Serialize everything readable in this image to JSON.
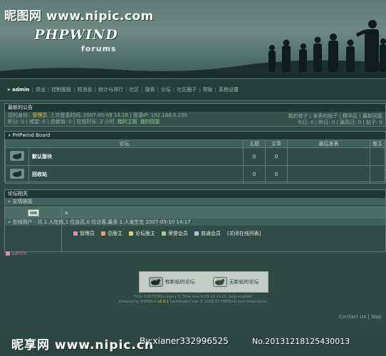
{
  "watermark": {
    "top": "昵图网 www.nipic.com",
    "bottom_brand": "昵享网 www.nipic.cn",
    "author": "By:xianer332996525",
    "number": "No.20131218125430013"
  },
  "logo": {
    "title": "PHPWIND",
    "subtitle": "forums"
  },
  "nav": {
    "user": "admin",
    "items": [
      "退出",
      "控制面板",
      "短消息",
      "统计与排行",
      "社区",
      "搜索",
      "论坛",
      "社区圈子",
      "帮助",
      "系统设置"
    ]
  },
  "notice": {
    "title": "最新的公告",
    "line1_prefix": "您的身份:",
    "admin_name": "管理员",
    "line1_rest": "上次登录时间: 2007-05-09 14:18 | 登录IP: 192.168.0.100",
    "line2": "积分: 0 | 威望: 0 | 贡献值: 0 | 在线时长: 2 小时",
    "line2_link1": "我的主题",
    "line2_link2": "我的回复",
    "right1": "我的帖子 | 发表的帖子 | 精华区 | 最新回复",
    "right2": "今日: 0 | 昨日: 0 | 最高日: 0 | 帖子: 0"
  },
  "board": {
    "title": "» PHPwind Board",
    "columns": [
      "论坛",
      "主题",
      "文章",
      "最后发表",
      "版主"
    ],
    "rows": [
      {
        "name": "默认版块",
        "topics": "0",
        "posts": "0"
      },
      {
        "name": "回收站",
        "topics": "0",
        "posts": "0"
      }
    ]
  },
  "related": {
    "title": "论坛相关",
    "links_head": "» 友情链接",
    "links_value": "a",
    "online_head": "» 在线用户 - 共 1 人在线,1 位会员,0 位访客,最多 1 人发生在 2007-05-10 14:17",
    "legend": [
      {
        "label": "管理员",
        "color": "#d98cb0"
      },
      {
        "label": "总版主",
        "color": "#d6a56a"
      },
      {
        "label": "论坛版主",
        "color": "#d9d07a"
      },
      {
        "label": "荣誉会员",
        "color": "#9bd08b"
      },
      {
        "label": "普通会员",
        "color": "#a9c4dc"
      }
    ],
    "legend_link": "[关闭在线列表]",
    "online_user": "admin"
  },
  "status": {
    "new": "有新帖的论坛",
    "nonew": "无新帖的论坛"
  },
  "footer": {
    "line1": "Total 0.007658(s) query 3, Time now is:05-10 14:22, Gzip enabled",
    "powered_prefix": "Powered by PHPWind",
    "version": "v5.0.1",
    "powered_rest": "Certificate Code © 2003-07 PHPWind.com Corporation",
    "links": "Contact Us | Wap"
  },
  "colors": {
    "background": "#2e4a43",
    "accent": "#e2c54a",
    "header": "#1e3732"
  }
}
